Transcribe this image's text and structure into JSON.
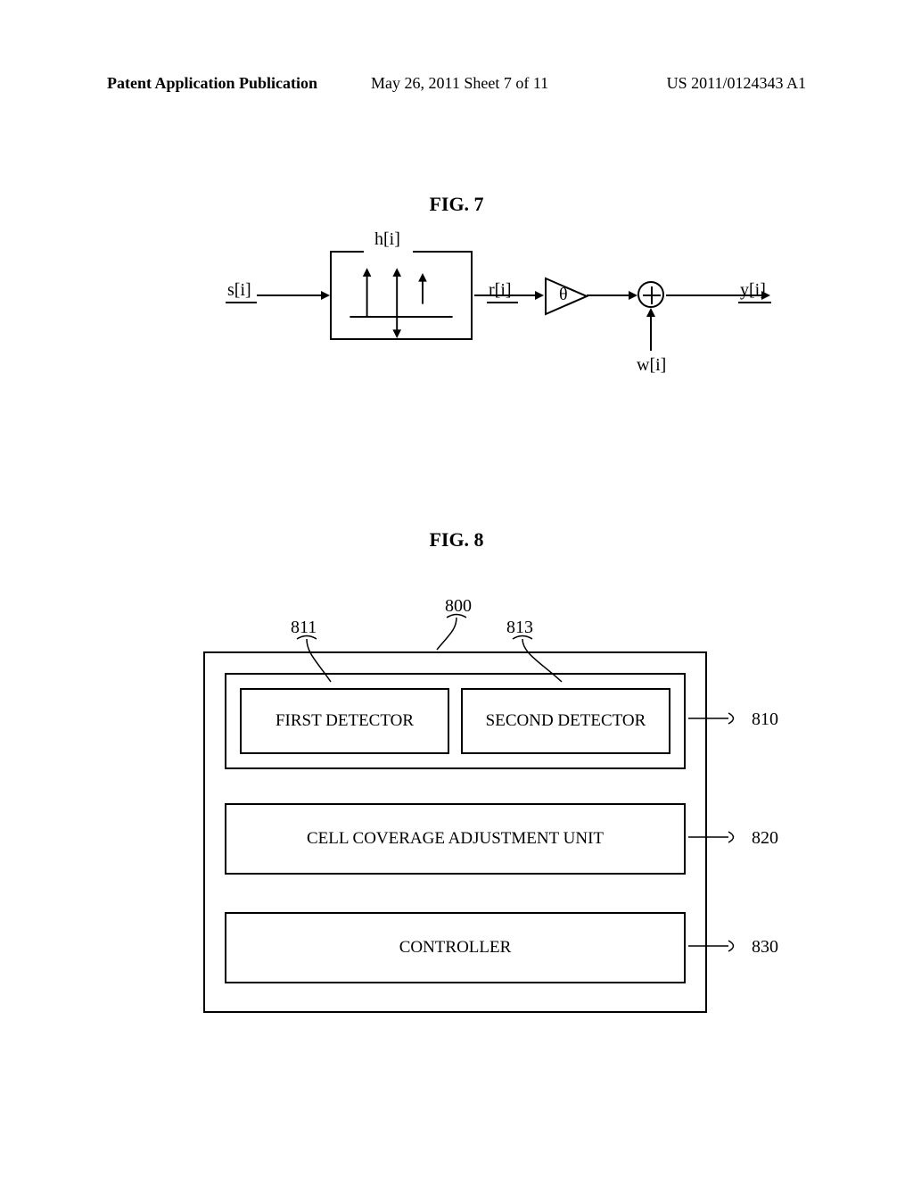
{
  "header": {
    "left": "Patent Application Publication",
    "center": "May 26, 2011  Sheet 7 of 11",
    "right": "US 2011/0124343 A1"
  },
  "fig7": {
    "title": "FIG. 7",
    "s": "s[i]",
    "h": "h[i]",
    "r": "r[i]",
    "theta": "θ",
    "w": "w[i]",
    "y": "y[i]"
  },
  "fig8": {
    "title": "FIG. 8",
    "ref800": "800",
    "ref811": "811",
    "ref813": "813",
    "ref810": "810",
    "ref820": "820",
    "ref830": "830",
    "first_detector": "FIRST DETECTOR",
    "second_detector": "SECOND DETECTOR",
    "ccau": "CELL COVERAGE ADJUSTMENT UNIT",
    "controller": "CONTROLLER"
  }
}
